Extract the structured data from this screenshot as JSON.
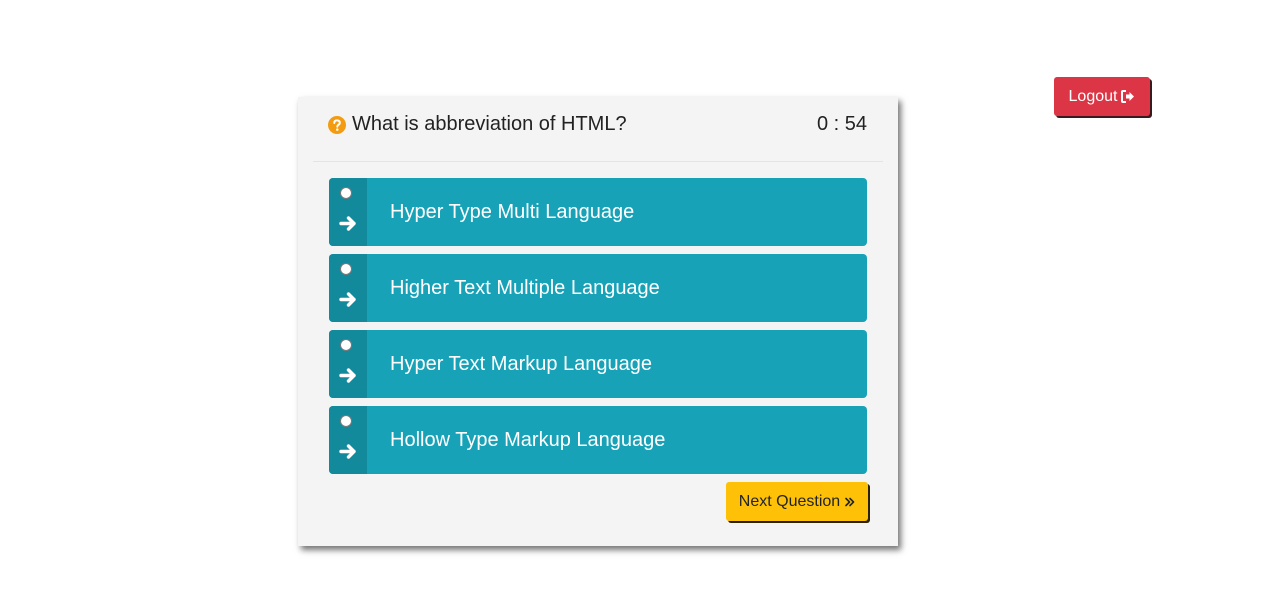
{
  "header": {
    "logout_label": "Logout"
  },
  "quiz": {
    "question": "What is abbreviation of HTML?",
    "timer": "0 : 54",
    "options": [
      {
        "label": "Hyper Type Multi Language"
      },
      {
        "label": "Higher Text Multiple Language"
      },
      {
        "label": "Hyper Text Markup Language"
      },
      {
        "label": "Hollow Type Markup Language"
      }
    ],
    "next_label": "Next Question"
  },
  "icons": {
    "logout": "sign-out-icon",
    "question": "question-circle-icon",
    "option_arrow": "arrow-right-icon",
    "next": "double-chevron-right-icon"
  },
  "colors": {
    "logout_button": "#dc3545",
    "option_background": "#17a2b8",
    "option_side": "#138a9c",
    "next_button": "#ffc107",
    "question_icon": "#f39c12",
    "card_background": "#f4f4f4"
  }
}
